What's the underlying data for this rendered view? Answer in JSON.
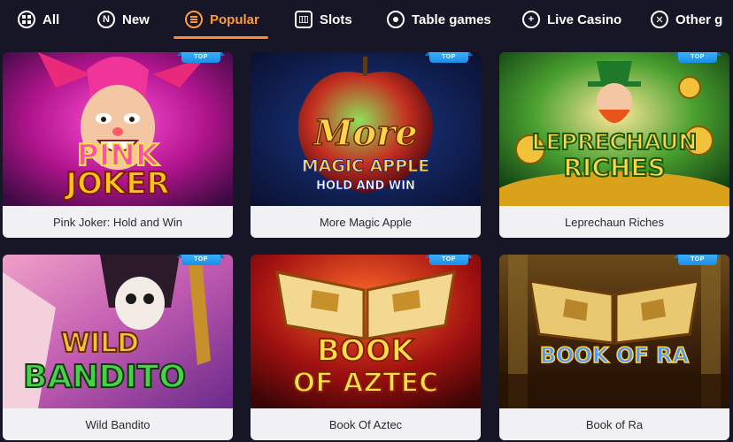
{
  "nav": {
    "tabs": [
      {
        "label": "All",
        "icon": "grid-icon"
      },
      {
        "label": "New",
        "icon": "n-badge-icon"
      },
      {
        "label": "Popular",
        "icon": "fire-icon",
        "active": true
      },
      {
        "label": "Slots",
        "icon": "slot-machine-icon"
      },
      {
        "label": "Table games",
        "icon": "poker-chip-icon"
      },
      {
        "label": "Live Casino",
        "icon": "live-plus-icon"
      },
      {
        "label": "Other g",
        "icon": "dice-icon"
      }
    ],
    "accent": "#ff8a2a"
  },
  "games": [
    {
      "name": "Pink Joker: Hold and Win",
      "badge": "TOP",
      "art_title": "PINK JOKER"
    },
    {
      "name": "More Magic Apple",
      "badge": "TOP",
      "art_title": "More",
      "art_sub1": "MAGIC APPLE",
      "art_sub2": "HOLD AND WIN"
    },
    {
      "name": "Leprechaun Riches",
      "badge": "TOP",
      "art_title": "LEPRECHAUN",
      "art_sub1": "RICHES"
    },
    {
      "name": "Wild Bandito",
      "badge": "TOP",
      "art_title": "WILD",
      "art_sub1": "BANDITO"
    },
    {
      "name": "Book Of Aztec",
      "badge": "TOP",
      "art_title": "BOOK",
      "art_sub1": "OF AZTEC"
    },
    {
      "name": "Book of Ra",
      "badge": "TOP",
      "art_title": "BOOK OF RA"
    }
  ]
}
